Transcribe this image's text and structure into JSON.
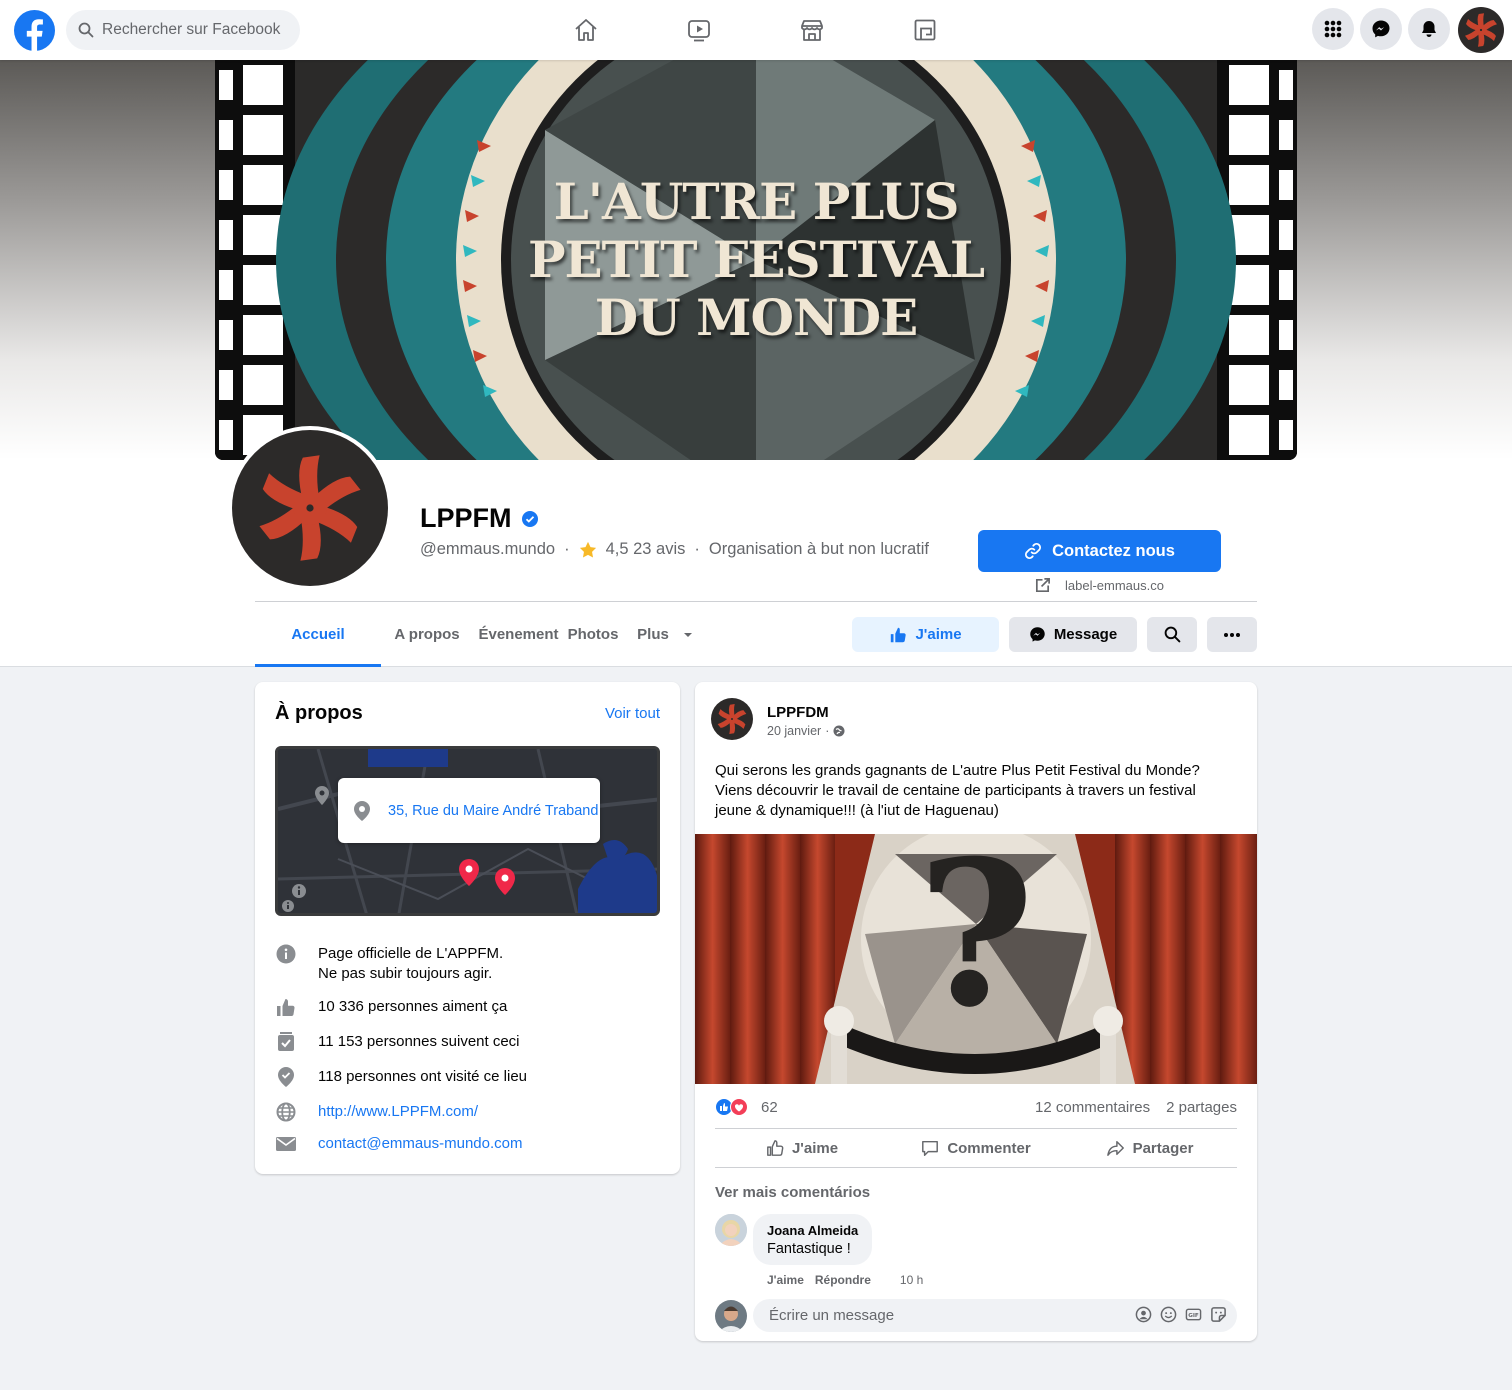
{
  "topbar": {
    "search_placeholder": "Rechercher sur Facebook",
    "nav_icons": [
      "home-icon",
      "watch-icon",
      "marketplace-icon",
      "gaming-icon"
    ],
    "right_icons": [
      "menu-grid-icon",
      "messenger-icon",
      "notifications-icon",
      "profile-avatar"
    ]
  },
  "cover": {
    "title_lines": [
      "L'AUTRE PLUS",
      "PETIT FESTIVAL",
      "DU MONDE"
    ]
  },
  "profile": {
    "name": "LPPFM",
    "handle": "@emmaus.mundo",
    "rating": "4,5 23 avis",
    "category": "Organisation à but non lucratif",
    "contact_button": "Contactez nous",
    "website_link": "label-emmaus.co",
    "verified": true
  },
  "tabs": [
    "Accueil",
    "A propos",
    "Évenement",
    "Photos",
    "Plus"
  ],
  "actions": {
    "like": "J'aime",
    "message": "Message"
  },
  "about": {
    "title": "À propos",
    "see_all": "Voir tout",
    "address": "35, Rue du Maire André Traband",
    "description_line1": "Page officielle de L'APPFM.",
    "description_line2": "Ne pas subir toujours agir.",
    "likes": "10 336 personnes aiment ça",
    "followers": "11 153 personnes suivent ceci",
    "visits": "118 personnes ont visité ce lieu",
    "website": "http://www.LPPFM.com/",
    "email": "contact@emmaus-mundo.com"
  },
  "post": {
    "author": "LPPFDM",
    "date": "20 janvier",
    "text_line1": "Qui serons les grands gagnants de L'autre Plus Petit Festival du Monde?",
    "text_line2": "Viens découvrir  le travail de centaine de participants à travers un festival",
    "text_line3": "jeune & dynamique!!! (à l'iut de Haguenau)",
    "reactions_count": "62",
    "comments_count": "12 commentaires",
    "shares_count": "2 partages",
    "action_like": "J'aime",
    "action_comment": "Commenter",
    "action_share": "Partager",
    "more_comments": "Ver mais comentários",
    "comment": {
      "author": "Joana Almeida",
      "text": "Fantastique !",
      "like": "J'aime",
      "reply": "Répondre",
      "time": "10 h"
    },
    "write_placeholder": "Écrire un message"
  },
  "colors": {
    "brand_blue": "#1877f2",
    "logo_red": "#c8432d",
    "logo_dark": "#2c2a29"
  }
}
